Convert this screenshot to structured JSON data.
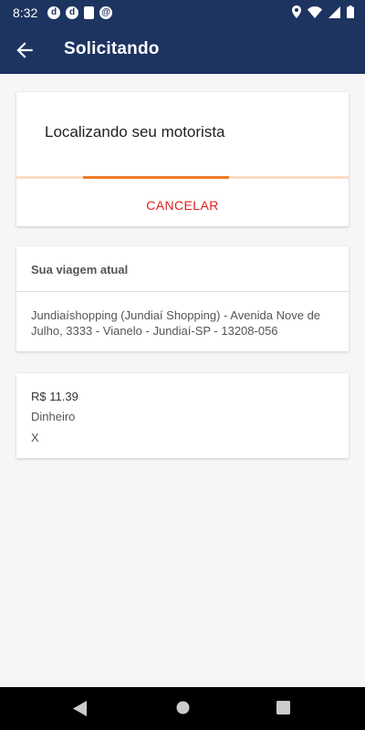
{
  "status_bar": {
    "time": "8:32",
    "left_icons": [
      "d-icon",
      "d-icon",
      "sd-card-icon",
      "at-sign-icon"
    ],
    "right_icons": [
      "location-icon",
      "wifi-icon",
      "signal-icon",
      "battery-icon"
    ]
  },
  "header": {
    "title": "Solicitando",
    "back_icon": "arrow-left-icon"
  },
  "request_card": {
    "heading": "Localizando seu motorista",
    "cancel_label": "CANCELAR"
  },
  "trip_card": {
    "title": "Sua viagem atual",
    "address": "Jundiaíshopping (Jundiaí Shopping) - Avenida Nove de Julho, 3333 - Vianelo - Jundiaí-SP - 13208-056"
  },
  "payment_card": {
    "price": "R$ 11.39",
    "method": "Dinheiro",
    "extra": "X"
  },
  "colors": {
    "primary": "#1d3461",
    "accent": "#f07a2a",
    "progress_track": "#fbdcc4",
    "cancel": "#e02020",
    "background": "#f7f5f6"
  }
}
